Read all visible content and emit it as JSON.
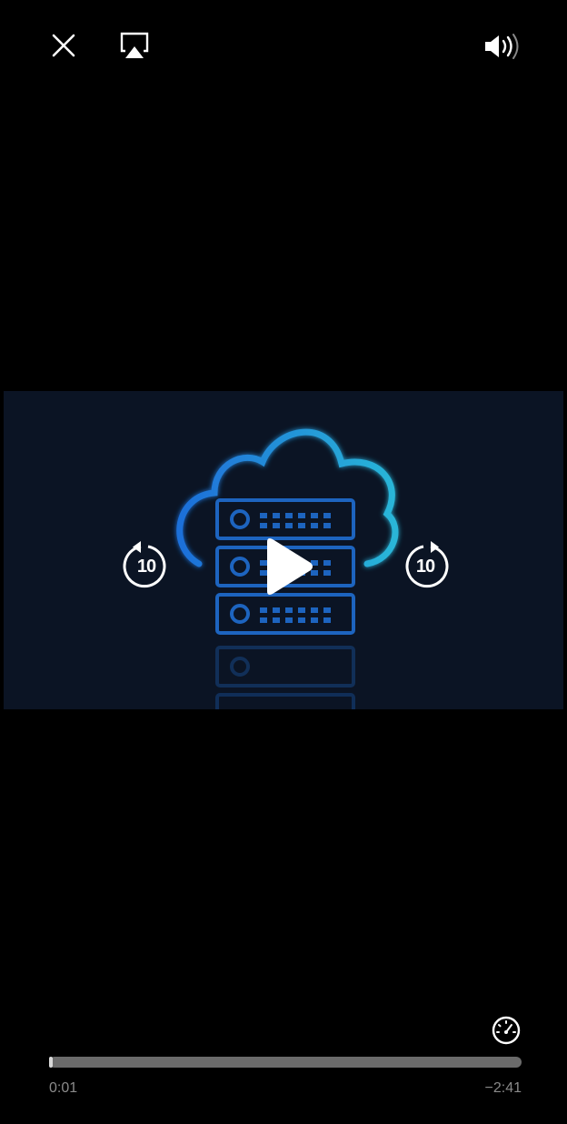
{
  "player": {
    "top_bar": {
      "close_icon": "close-icon",
      "airplay_icon": "airplay-icon",
      "volume_icon": "volume-icon"
    },
    "controls": {
      "skip_back_seconds": "10",
      "skip_forward_seconds": "10",
      "play_icon": "play-icon",
      "speed_icon": "playback-speed-icon"
    },
    "progress": {
      "elapsed": "0:01",
      "remaining": "−2:41",
      "fraction": 0.006
    },
    "colors": {
      "background": "#000000",
      "video_bg": "#0b1424",
      "art_blue": "#1e6fd9",
      "art_cyan": "#29b6d8"
    }
  }
}
